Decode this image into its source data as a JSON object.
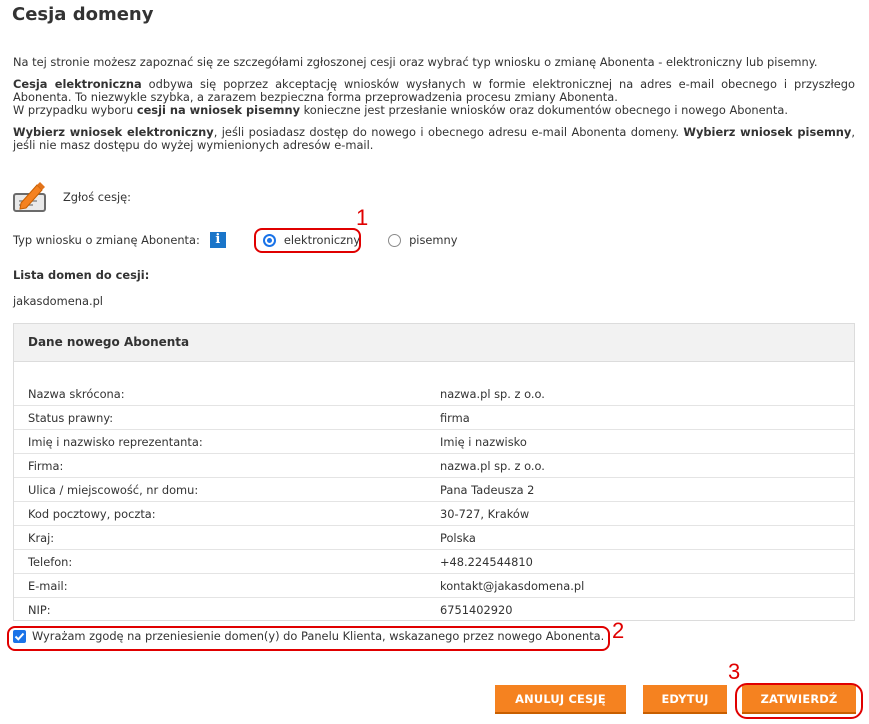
{
  "page_title": "Cesja domeny",
  "intro": {
    "p1": "Na tej stronie możesz zapoznać się ze szczegółami zgłoszonej cesji oraz wybrać typ wniosku o zmianę Abonenta - elektroniczny lub pisemny.",
    "p2_bold": "Cesja elektroniczna",
    "p2_rest": " odbywa się poprzez akceptację wniosków wysłanych w formie elektronicznej na adres e-mail obecnego i przyszłego Abonenta. To niezwykle szybka, a zarazem bezpieczna forma przeprowadzenia procesu zmiany Abonenta.",
    "p2_line2_a": "W przypadku wyboru ",
    "p2_line2_bold": "cesji na wniosek pisemny",
    "p2_line2_b": " konieczne jest przesłanie wniosków oraz dokumentów obecnego i nowego Abonenta.",
    "p3_bold1": "Wybierz wniosek elektroniczny",
    "p3_a": ", jeśli posiadasz dostęp do nowego i obecnego adresu e-mail Abonenta domeny. ",
    "p3_bold2": "Wybierz wniosek pisemny",
    "p3_b": ", jeśli nie masz dostępu do wyżej wymienionych adresów e-mail."
  },
  "cession_label": "Zgłoś cesję:",
  "request_type": {
    "label": "Typ wniosku o zmianę Abonenta:",
    "info_icon": "i",
    "options": [
      "elektroniczny",
      "pisemny"
    ],
    "selected": "elektroniczny"
  },
  "domain_list": {
    "title": "Lista domen do cesji:",
    "domains": [
      "jakasdomena.pl"
    ]
  },
  "new_holder": {
    "title": "Dane nowego Abonenta",
    "rows": [
      {
        "label": "Nazwa skrócona:",
        "value": "nazwa.pl sp. z o.o."
      },
      {
        "label": "Status prawny:",
        "value": "firma"
      },
      {
        "label": "Imię i nazwisko reprezentanta:",
        "value": "Imię i nazwisko"
      },
      {
        "label": "Firma:",
        "value": "nazwa.pl sp. z o.o."
      },
      {
        "label": "Ulica / miejscowość, nr domu:",
        "value": "Pana Tadeusza 2"
      },
      {
        "label": "Kod pocztowy, poczta:",
        "value": "30-727, Kraków"
      },
      {
        "label": "Kraj:",
        "value": "Polska"
      },
      {
        "label": "Telefon:",
        "value": "+48.224544810"
      },
      {
        "label": "E-mail:",
        "value": "kontakt@jakasdomena.pl"
      },
      {
        "label": "NIP:",
        "value": "6751402920"
      }
    ]
  },
  "consent": {
    "checked": true,
    "label": "Wyrażam zgodę na przeniesienie domen(y) do Panelu Klienta, wskazanego przez nowego Abonenta."
  },
  "buttons": {
    "cancel": "ANULUJ CESJĘ",
    "edit": "EDYTUJ",
    "confirm": "ZATWIERDŹ"
  },
  "annotations": [
    "1",
    "2",
    "3"
  ],
  "colors": {
    "accent": "#f58220",
    "annotation": "#e00000",
    "selection": "#1a73e8",
    "info": "#1a75c9"
  }
}
